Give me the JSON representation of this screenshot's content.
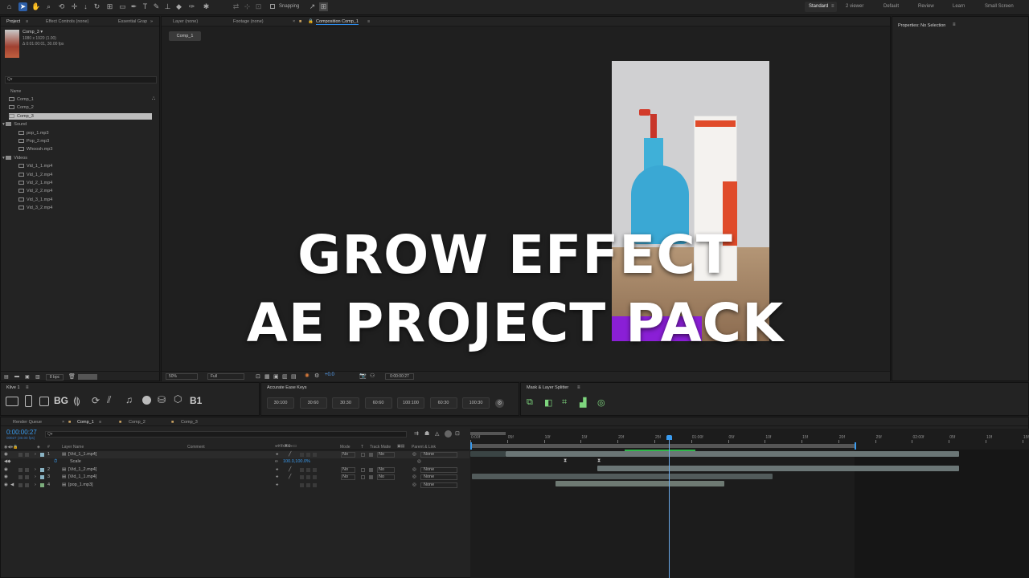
{
  "toolbar": {
    "snapping_label": "Snapping",
    "workspaces": [
      "Standard",
      "2 viewer",
      "Default",
      "Review",
      "Learn",
      "Small Screen"
    ]
  },
  "project_panel": {
    "tabs": [
      "Project",
      "Effect Controls (none)",
      "Essential Grap"
    ],
    "comp_name": "Comp_3 ▾",
    "comp_info_line1": "1080 x 1920 (1.00)",
    "comp_info_line2": "Δ 0:01:00:01, 30.00 fps",
    "search_placeholder": "Q▾",
    "column_name": "Name",
    "items": [
      {
        "label": "Comp_1",
        "type": "comp",
        "indent": 0
      },
      {
        "label": "Comp_2",
        "type": "comp",
        "indent": 0
      },
      {
        "label": "Comp_3",
        "type": "comp",
        "indent": 0,
        "selected": true
      },
      {
        "label": "Sound",
        "type": "folder",
        "indent": 0
      },
      {
        "label": "pop_1.mp3",
        "type": "file",
        "indent": 1
      },
      {
        "label": "Pop_2.mp3",
        "type": "file",
        "indent": 1
      },
      {
        "label": "Whoosh.mp3",
        "type": "file",
        "indent": 1
      },
      {
        "label": "Videos",
        "type": "folder",
        "indent": 0
      },
      {
        "label": "Vid_1_1.mp4",
        "type": "file",
        "indent": 1
      },
      {
        "label": "Vid_1_2.mp4",
        "type": "file",
        "indent": 1
      },
      {
        "label": "Vid_2_1.mp4",
        "type": "file",
        "indent": 1
      },
      {
        "label": "Vid_2_2.mp4",
        "type": "file",
        "indent": 1
      },
      {
        "label": "Vid_3_1.mp4",
        "type": "file",
        "indent": 1
      },
      {
        "label": "Vid_3_2.mp4",
        "type": "file",
        "indent": 1
      }
    ],
    "bpc_label": "8 bpc"
  },
  "viewer": {
    "tabs": [
      "Layer (none)",
      "Footage (none)",
      "Composition Comp_1"
    ],
    "comp_chip": "Comp_1",
    "zoom": "50%",
    "resolution": "Full",
    "exposure": "+0.0",
    "timecode": "0:00:00:27"
  },
  "overlay": {
    "line1": "GROW EFFECT",
    "line2": "AE PROJECT PACK"
  },
  "properties": {
    "title": "Properties: No Selection"
  },
  "klive_panel": {
    "title": "Klive 1",
    "labels": [
      "BG",
      "B1"
    ]
  },
  "ease_panel": {
    "title": "Accurate Ease Keys",
    "buttons": [
      "30:100",
      "30:60",
      "30:30",
      "60:60",
      "100:100",
      "60:30",
      "100:30"
    ]
  },
  "mask_panel": {
    "title": "Mask & Layer Splitter"
  },
  "timeline": {
    "tabs": [
      "Render Queue",
      "Comp_1",
      "Comp_2",
      "Comp_3"
    ],
    "current_time": "0:00:00:27",
    "frame_info": "00027 (30.00 fps)",
    "search_placeholder": "Q▾",
    "headers": {
      "layer_name": "Layer Name",
      "comment": "Comment",
      "mode": "Mode",
      "t": "T",
      "track_matte": "Track Matte",
      "parent": "Parent & Link"
    },
    "layers": [
      {
        "num": "1",
        "name": "[Vid_1_1.mp4]",
        "mode": "No",
        "matte": "No",
        "parent": "None",
        "expanded": true
      },
      {
        "num": "",
        "name": "Scale",
        "scale_value": "100.0,100.0%",
        "is_property": true
      },
      {
        "num": "2",
        "name": "[Vid_1_2.mp4]",
        "mode": "No",
        "matte": "No",
        "parent": "None"
      },
      {
        "num": "3",
        "name": "[Vid_1_1.mp4]",
        "mode": "No",
        "matte": "No",
        "parent": "None"
      },
      {
        "num": "4",
        "name": "[pop_1.mp3]",
        "mode": "",
        "matte": "",
        "parent": "None"
      }
    ],
    "ruler_labels": [
      "0:00f",
      "05f",
      "10f",
      "15f",
      "20f",
      "25f",
      "01:00f",
      "05f",
      "10f",
      "15f",
      "20f",
      "25f",
      "02:00f",
      "05f",
      "10f",
      "15f"
    ],
    "playhead_frame": 27,
    "frame_start": 0,
    "frame_end": 76
  },
  "colors": {
    "accent_blue": "#2d8ceb",
    "overlay_purple": "#8a1fd6",
    "bottle_cyan": "#3fb0d8",
    "panel_bg": "#232323"
  }
}
